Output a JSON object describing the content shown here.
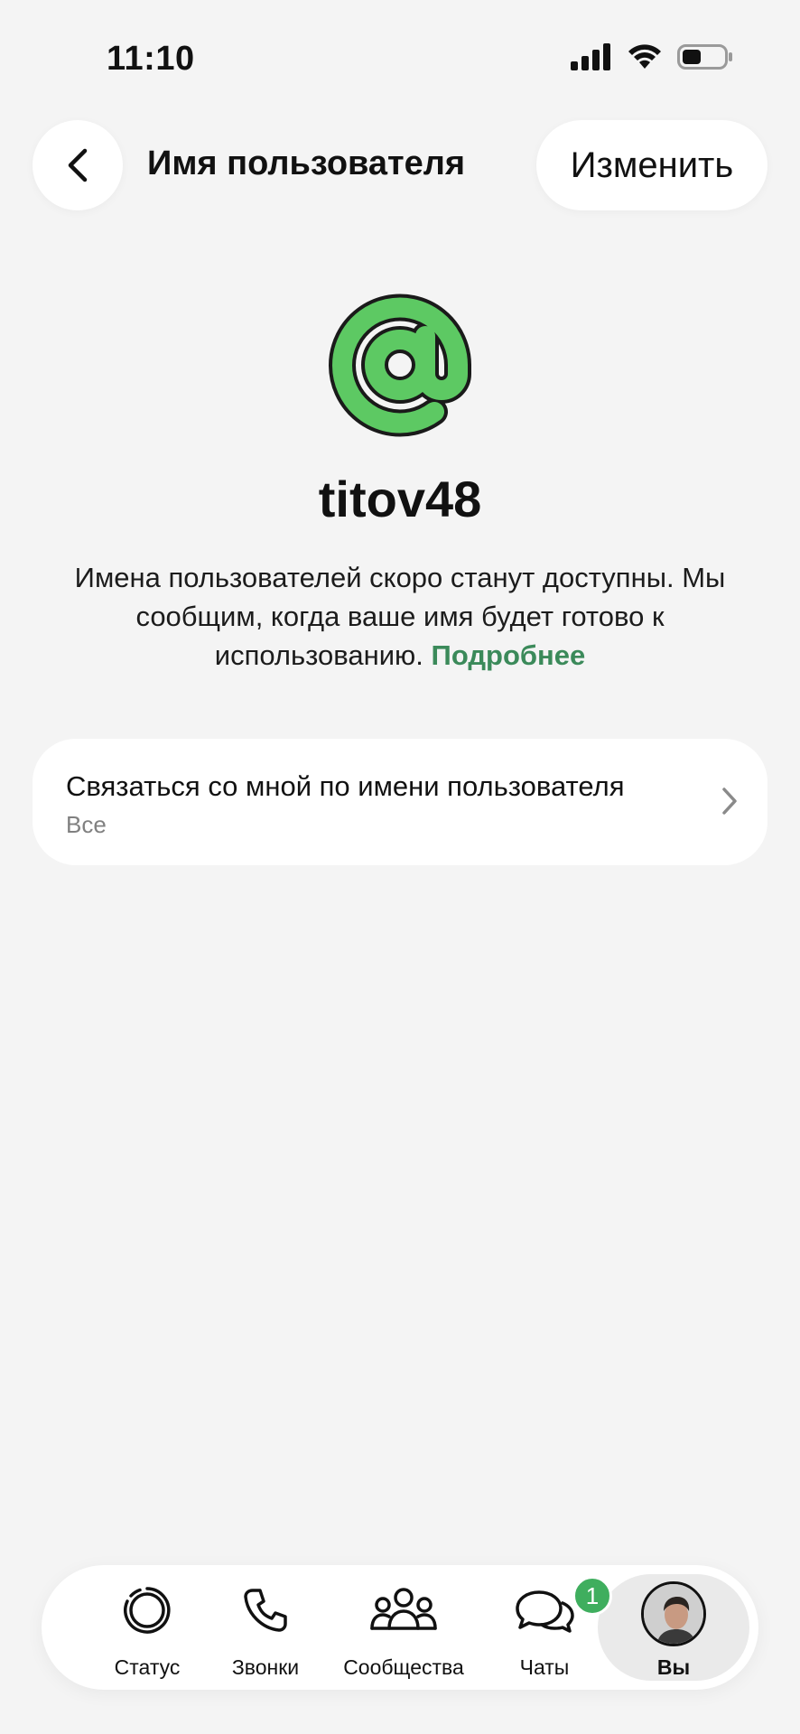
{
  "status_bar": {
    "time": "11:10"
  },
  "header": {
    "title": "Имя пользователя",
    "edit_label": "Изменить"
  },
  "profile": {
    "username": "titov48",
    "description": "Имена пользователей скоро станут доступны. Мы сообщим, когда ваше имя будет готово к использованию. ",
    "learn_more": "Подробнее"
  },
  "setting": {
    "title": "Связаться со мной по имени пользователя",
    "value": "Все"
  },
  "tab_bar": {
    "tabs": [
      {
        "label": "Статус",
        "icon": "status-icon"
      },
      {
        "label": "Звонки",
        "icon": "phone-icon"
      },
      {
        "label": "Сообщества",
        "icon": "communities-icon"
      },
      {
        "label": "Чаты",
        "icon": "chats-icon",
        "badge": "1"
      },
      {
        "label": "Вы",
        "icon": "avatar",
        "selected": true
      }
    ]
  },
  "colors": {
    "accent_green": "#3fae5e",
    "link_green": "#3b8a5a",
    "background": "#f4f4f4"
  }
}
